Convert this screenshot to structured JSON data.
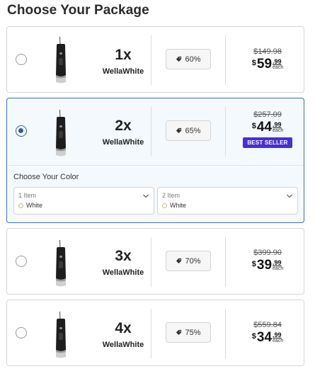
{
  "page": {
    "title": "Choose Your Package"
  },
  "packages": [
    {
      "qty": "1x",
      "brand": "WellaWhite",
      "discount": "60%",
      "old_price": "$149.98",
      "price_dollar": "$",
      "price_int": "59",
      "price_cents": ".99",
      "price_each": "each",
      "selected": false
    },
    {
      "qty": "2x",
      "brand": "WellaWhite",
      "discount": "65%",
      "old_price": "$257.09",
      "price_dollar": "$",
      "price_int": "44",
      "price_cents": ".99",
      "price_each": "each",
      "badge": "BEST SELLER",
      "selected": true
    },
    {
      "qty": "3x",
      "brand": "WellaWhite",
      "discount": "70%",
      "old_price": "$399.90",
      "price_dollar": "$",
      "price_int": "39",
      "price_cents": ".99",
      "price_each": "each",
      "selected": false
    },
    {
      "qty": "4x",
      "brand": "WellaWhite",
      "discount": "75%",
      "old_price": "$559.84",
      "price_dollar": "$",
      "price_int": "34",
      "price_cents": ".99",
      "price_each": "each",
      "selected": false
    }
  ],
  "color_chooser": {
    "title": "Choose Your Color",
    "selects": [
      {
        "item_label": "1 Item",
        "value": "White"
      },
      {
        "item_label": "2 Item",
        "value": "White"
      }
    ]
  },
  "colors": {
    "selected_border": "#3c6fb6",
    "selected_bg": "#f3f9fd",
    "badge": "#4a2ed6"
  },
  "icons": {
    "discount": "tag-icon",
    "dropdown": "chevron-down-icon",
    "product": "water-flosser-image"
  }
}
